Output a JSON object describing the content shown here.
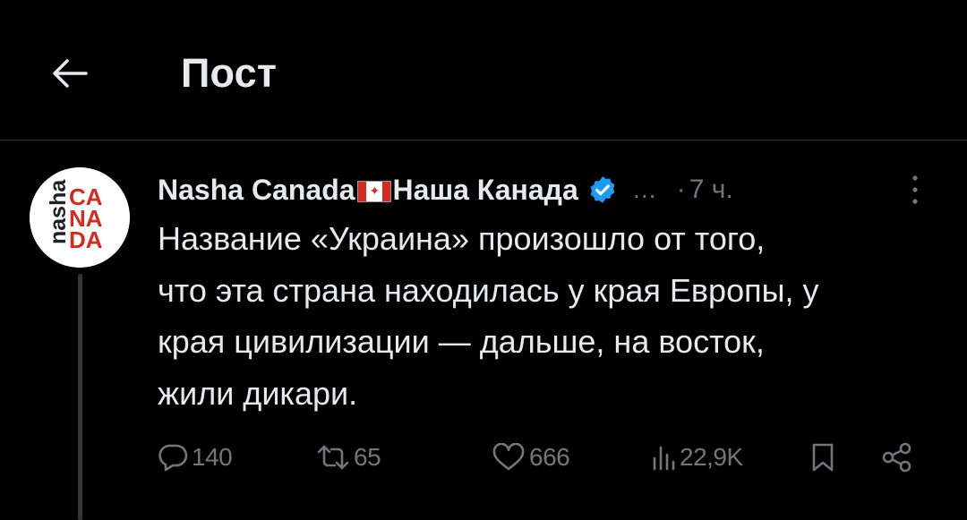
{
  "header": {
    "title": "Пост",
    "back_icon": "arrow-left-icon"
  },
  "tweet": {
    "author_name_part1": "Nasha Canada",
    "author_flag": "canada-flag-icon",
    "author_name_part2": "Наша Канада",
    "verified_icon": "verified-badge-icon",
    "handle_truncated": "…",
    "time_sep": "·",
    "time": "7 ч.",
    "more_icon": "more-vertical-icon",
    "avatar": {
      "logo_side_text": "nasha",
      "logo_lines": [
        "CA",
        "NA",
        "DA"
      ]
    },
    "text_lines": [
      "Название «Украина» произошло от того,",
      "что эта страна находилась у края Европы, у",
      "края цивилизации — дальше, на восток,",
      "жили дикари."
    ]
  },
  "actions": {
    "replies": "140",
    "reposts": "65",
    "likes": "666",
    "views": "22,9K"
  },
  "colors": {
    "background": "#000000",
    "text": "#e7e9ea",
    "secondary": "#71767b",
    "verified": "#1d9bf0",
    "brand_red": "#d52b1e",
    "divider": "#2f3336"
  }
}
